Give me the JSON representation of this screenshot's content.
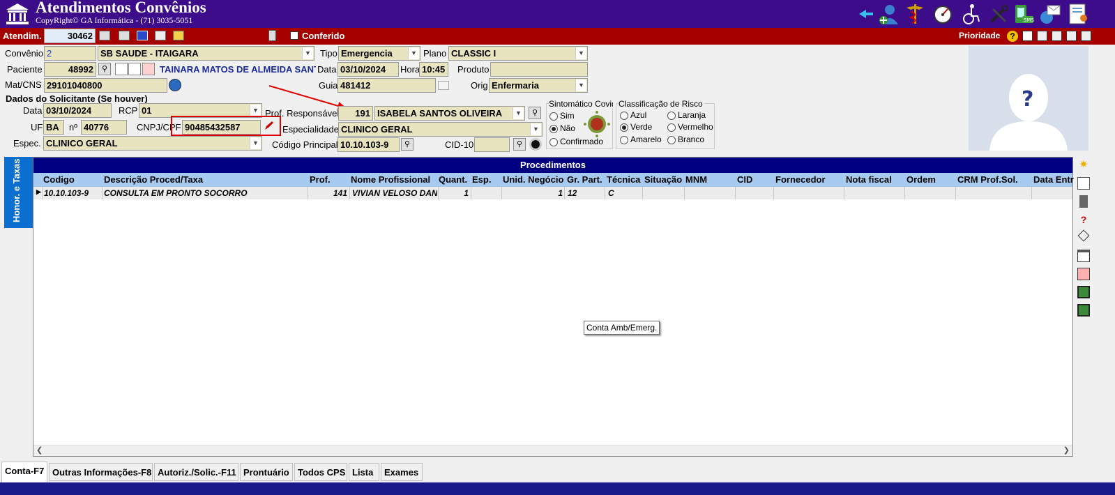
{
  "app": {
    "title": "Atendimentos Convênios",
    "copyright": "CopyRight© GA Informática - (71) 3035-5051"
  },
  "toolbar": {
    "atendim_label": "Atendim.",
    "atendim_value": "30462",
    "conferido_label": "Conferido",
    "prioridade_label": "Prioridade"
  },
  "form": {
    "convenio_label": "Convênio",
    "convenio_code": "2",
    "convenio_name": "SB SAUDE - ITAIGARA",
    "tipo_label": "Tipo",
    "tipo_value": "Emergencia",
    "plano_label": "Plano",
    "plano_value": "CLASSIC I",
    "paciente_label": "Paciente",
    "paciente_code": "48992",
    "paciente_name": "TAINARA MATOS DE ALMEIDA SANTA",
    "data_label": "Data",
    "data_value": "03/10/2024",
    "hora_label": "Hora",
    "hora_value": "10:45",
    "produto_label": "Produto",
    "produto_value": "",
    "matcns_label": "Mat/CNS",
    "matcns_value": "29101040800",
    "guia_label": "Guia",
    "guia_value": "481412",
    "orig_label": "Orig",
    "orig_value": "Enfermaria",
    "solicitante_title": "Dados do Solicitante (Se houver)",
    "sol_data_label": "Data",
    "sol_data_value": "03/10/2024",
    "rcp_label": "RCP",
    "rcp_value": "01",
    "uf_label": "UF",
    "uf_value": "BA",
    "numero_label": "nº",
    "numero_value": "40776",
    "cnpj_label": "CNPJ/CPF",
    "cnpj_value": "90485432587",
    "espec_label": "Espec.",
    "espec_value": "CLINICO GERAL",
    "prof_label": "Prof. Responsável",
    "prof_code": "191",
    "prof_name": "ISABELA SANTOS OLIVEIRA",
    "especialidade_label": "Especialidade",
    "especialidade_value": "CLINICO GERAL",
    "codigo_principal_label": "Código Principal",
    "codigo_principal_value": "10.10.103-9",
    "cid_label": "CID-10",
    "cid_value": ""
  },
  "sintomatico": {
    "title": "Sintomático Covid",
    "options": [
      "Sim",
      "Não",
      "Confirmado"
    ],
    "selected": "Não"
  },
  "risco": {
    "title": "Classificação de Risco",
    "options": [
      "Azul",
      "Laranja",
      "Verde",
      "Vermelho",
      "Amarelo",
      "Branco"
    ],
    "selected": "Verde"
  },
  "side_tab_label": "Honor. e Taxas",
  "grid": {
    "caption": "Procedimentos",
    "columns": [
      "Codigo",
      "Descrição Proced/Taxa",
      "Prof.",
      "Nome Profissional",
      "Quant.",
      "Esp.",
      "Unid. Negócio",
      "Gr. Part.",
      "Técnica",
      "Situação",
      "MNM",
      "CID",
      "Fornecedor",
      "Nota fiscal",
      "Ordem",
      "CRM Prof.Sol.",
      "Data Entr"
    ],
    "rows": [
      {
        "codigo": "10.10.103-9",
        "descricao": "CONSULTA EM PRONTO SOCORRO",
        "prof": "141",
        "nome": "VIVIAN VELOSO DAN",
        "quant": "1",
        "esp": "",
        "unid": "1",
        "grpart": "12",
        "tecnica": "C"
      }
    ]
  },
  "tooltip": "Conta Amb/Emerg.",
  "tabs": [
    "Conta-F7",
    "Outras Informações-F8",
    "Autoriz./Solic.-F11",
    "Prontuário",
    "Todos CPS",
    "Lista",
    "Exames"
  ],
  "colors": {
    "title_bar": "#3c0c8a",
    "red_bar": "#a50000",
    "grid_caption": "#000080",
    "grid_header": "#a6caf0",
    "side_tab": "#0c6fd0",
    "field_bg": "#e8e4c0",
    "highlight_box": "#e00000"
  }
}
